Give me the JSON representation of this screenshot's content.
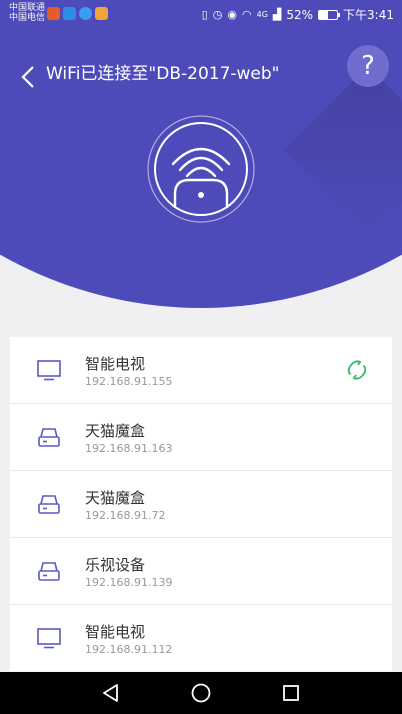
{
  "status_bar": {
    "carrier_1": "中国联通",
    "carrier_2": "中国电信",
    "app_icon_colors": [
      "#e35d2a",
      "#2d8ee6",
      "#3b9df1",
      "#f2a33a"
    ],
    "network_label": "4G",
    "battery_percent_text": "52%",
    "battery_level": 0.52,
    "time": "下午3:41"
  },
  "header": {
    "back_icon": "chevron-left-icon",
    "title": "WiFi已连接至\"DB-2017-web\"",
    "help_label": "?"
  },
  "router": {
    "icon": "wifi-router-icon"
  },
  "devices": [
    {
      "name": "智能电视",
      "ip": "192.168.91.155",
      "icon": "tv-icon",
      "link_status_icon": "link-icon"
    },
    {
      "name": "天猫魔盒",
      "ip": "192.168.91.163",
      "icon": "set-top-box-icon"
    },
    {
      "name": "天猫魔盒",
      "ip": "192.168.91.72",
      "icon": "set-top-box-icon"
    },
    {
      "name": "乐视设备",
      "ip": "192.168.91.139",
      "icon": "set-top-box-icon"
    },
    {
      "name": "智能电视",
      "ip": "192.168.91.112",
      "icon": "tv-icon"
    }
  ],
  "colors": {
    "brand": "#4d4bb9",
    "accent_icon": "#5b59c4",
    "link_green": "#3db86a",
    "background": "#f0f0f3"
  },
  "nav_bar": {
    "back": "back-triangle-icon",
    "home": "home-circle-icon",
    "recents": "recents-square-icon"
  }
}
